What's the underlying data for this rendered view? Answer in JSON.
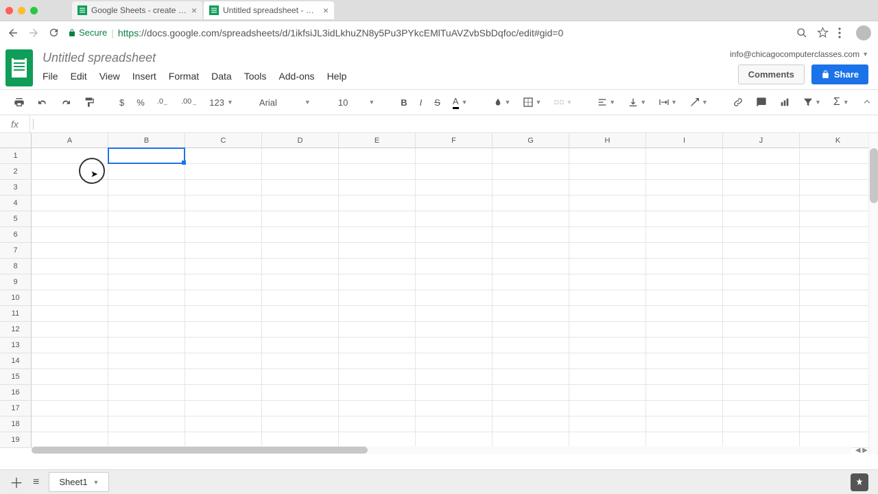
{
  "browser": {
    "tabs": [
      {
        "title": "Google Sheets - create and ed"
      },
      {
        "title": "Untitled spreadsheet - Google"
      }
    ],
    "secure_label": "Secure",
    "url_protocol": "https",
    "url_rest": "://docs.google.com/spreadsheets/d/1ikfsiJL3idLkhuZN8y5Pu3PYkcEMlTuAVZvbSbDqfoc/edit#gid=0"
  },
  "doc": {
    "title": "Untitled spreadsheet",
    "user_email": "info@chicagocomputerclasses.com",
    "comments_label": "Comments",
    "share_label": "Share"
  },
  "menus": [
    "File",
    "Edit",
    "View",
    "Insert",
    "Format",
    "Data",
    "Tools",
    "Add-ons",
    "Help"
  ],
  "toolbar": {
    "currency": "$",
    "percent": "%",
    "dec_minus": ".0",
    "dec_plus": ".00",
    "more_formats": "123",
    "font": "Arial",
    "size": "10",
    "bold": "B",
    "italic": "I",
    "strike": "S",
    "textcolor": "A"
  },
  "formula": {
    "fx": "fx",
    "value": ""
  },
  "grid": {
    "columns": [
      "A",
      "B",
      "C",
      "D",
      "E",
      "F",
      "G",
      "H",
      "I",
      "J",
      "K"
    ],
    "rows": 19,
    "selected": "B1"
  },
  "sheet": {
    "name": "Sheet1",
    "add": "+",
    "all": "≡"
  }
}
